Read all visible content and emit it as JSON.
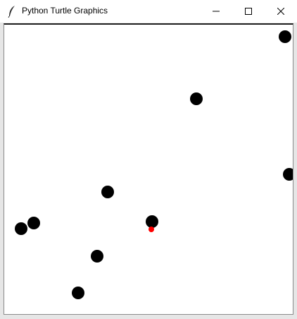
{
  "window": {
    "title": "Python Turtle Graphics",
    "app_icon": "feather-icon",
    "controls": {
      "minimize": "minimize-icon",
      "maximize": "maximize-icon",
      "close": "close-icon"
    }
  },
  "canvas": {
    "background": "#ffffff",
    "dot_color": "#000000",
    "turtle_color": "#ff0000"
  }
}
